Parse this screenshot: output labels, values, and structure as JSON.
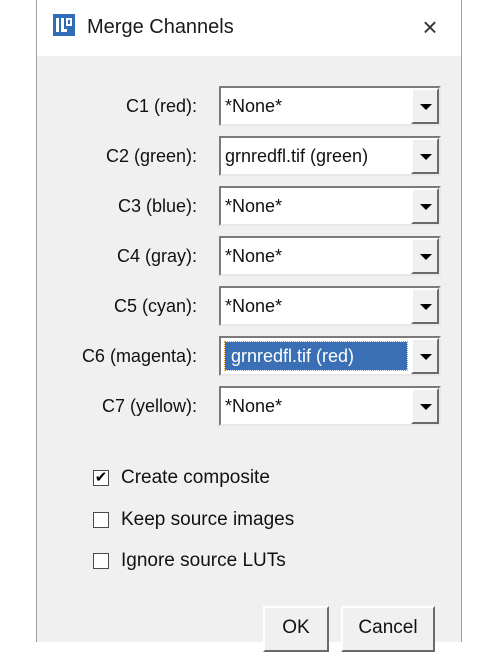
{
  "window": {
    "title": "Merge Channels",
    "close_glyph": "×",
    "icon": "imagej-icon"
  },
  "channels": [
    {
      "label": "C1 (red):",
      "value": "*None*"
    },
    {
      "label": "C2 (green):",
      "value": "grnredfl.tif (green)"
    },
    {
      "label": "C3 (blue):",
      "value": "*None*"
    },
    {
      "label": "C4 (gray):",
      "value": "*None*"
    },
    {
      "label": "C5 (cyan):",
      "value": "*None*"
    },
    {
      "label": "C6 (magenta):",
      "value": "grnredfl.tif (red)",
      "focused": true
    },
    {
      "label": "C7 (yellow):",
      "value": "*None*"
    }
  ],
  "options": [
    {
      "label": "Create composite",
      "checked": true,
      "mark": "✔"
    },
    {
      "label": "Keep source images",
      "checked": false
    },
    {
      "label": "Ignore source LUTs",
      "checked": false
    }
  ],
  "buttons": {
    "ok": "OK",
    "cancel": "Cancel"
  },
  "colors": {
    "selection": "#3a6fb5",
    "dialog_bg": "#f0f0f0"
  }
}
